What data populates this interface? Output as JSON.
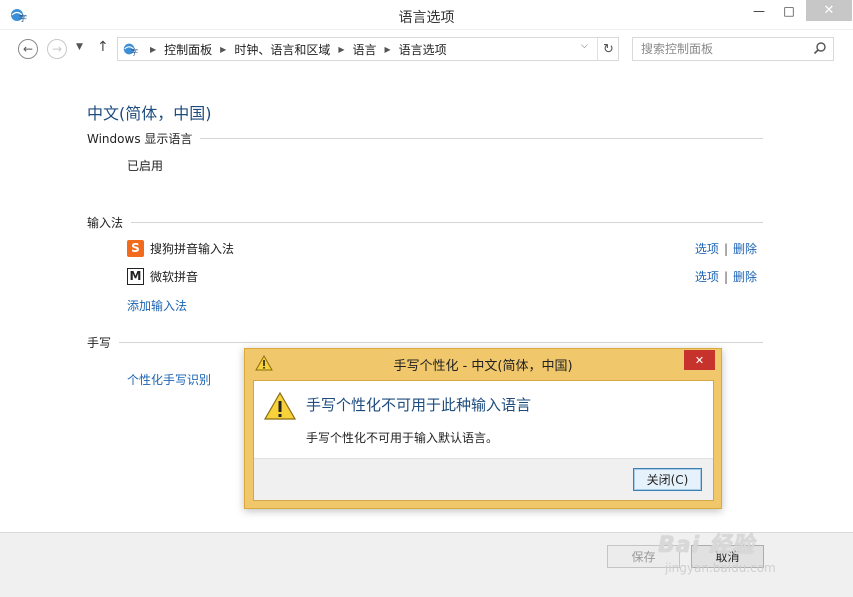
{
  "window": {
    "title": "语言选项",
    "minimize": "—",
    "maximize": "□",
    "close": "✕"
  },
  "nav": {
    "breadcrumbs": [
      "控制面板",
      "时钟、语言和区域",
      "语言",
      "语言选项"
    ],
    "search_placeholder": "搜索控制面板"
  },
  "content": {
    "language_title": "中文(简体，中国)",
    "display_section": "Windows 显示语言",
    "display_status": "已启用",
    "ime_section": "输入法",
    "ime_items": [
      {
        "name": "搜狗拼音输入法",
        "logo": "S",
        "options": "选项",
        "remove": "删除"
      },
      {
        "name": "微软拼音",
        "logo": "M",
        "options": "选项",
        "remove": "删除"
      }
    ],
    "add_ime": "添加输入法",
    "handwriting_section": "手写",
    "handwriting_link": "个性化手写识别"
  },
  "footer": {
    "save": "保存",
    "cancel": "取消"
  },
  "dialog": {
    "title": "手写个性化 - 中文(简体，中国)",
    "heading": "手写个性化不可用于此种输入语言",
    "message": "手写个性化不可用于输入默认语言。",
    "close_button": "关闭(C)"
  },
  "watermark": {
    "text": "Bai 经验",
    "url": "jingyan.baidu.com"
  },
  "colors": {
    "accent": "#1e4c7e",
    "link": "#1c64b4",
    "dialog_frame": "#f0c86b",
    "close_red": "#c7332c"
  }
}
